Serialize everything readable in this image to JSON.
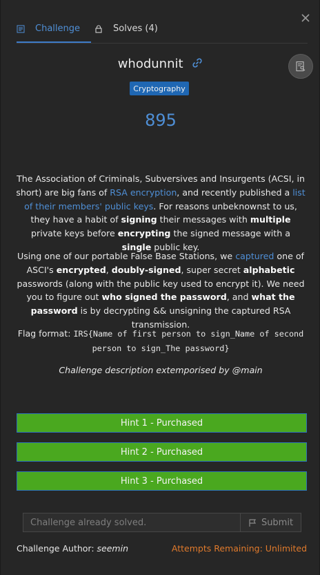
{
  "tabs": {
    "challenge": "Challenge",
    "solves": "Solves (4)"
  },
  "challenge": {
    "name": "whodunnit",
    "category": "Cryptography",
    "points": "895"
  },
  "description": {
    "p1": {
      "t1": "The Association of Criminals, Subversives and Insurgents (ACSI, in short) are big fans of ",
      "link1": "RSA encryption",
      "t2": ", and recently published a ",
      "link2": "list of their members' public keys",
      "t3": ". For reasons unbeknownst to us, they have a habit of ",
      "b1": "signing",
      "t4": " their messages with ",
      "b2": "multiple",
      "t5": " private keys before ",
      "b3": "encrypting",
      "t6": " the signed message with a ",
      "b4": "single",
      "t7": " public key."
    },
    "p2": {
      "t1": "Using one of our portable False Base Stations, we ",
      "link1": "captured",
      "t2": " one of ASCI's ",
      "b1": "encrypted",
      "t3": ", ",
      "b2": "doubly-signed",
      "t4": ", super secret ",
      "b3": "alphabetic",
      "t5": " passwords (along with the public key used to encrypt it). We need you to figure out ",
      "b4": "who signed the password",
      "t6": ", and ",
      "b5": "what the password",
      "t7": " is by decrypting && unsigning the captured RSA transmission."
    },
    "p3": {
      "label": "Flag format: ",
      "code": "IRS{Name of first person to sign_Name of second person to sign_The password}"
    },
    "p4": "Challenge description extemporised by @main"
  },
  "hints": [
    "Hint 1 - Purchased",
    "Hint 2 - Purchased",
    "Hint 3 - Purchased"
  ],
  "submission": {
    "placeholder": "Challenge already solved.",
    "submit_label": "Submit"
  },
  "footer": {
    "author_label": "Challenge Author:",
    "author_name": "seemin",
    "attempts": "Attempts Remaining: Unlimited"
  },
  "colors": {
    "accent": "#4f8fd6",
    "badge": "#1f67b3",
    "hint_green": "#4aa81f",
    "attempts_orange": "#e07a2c"
  }
}
